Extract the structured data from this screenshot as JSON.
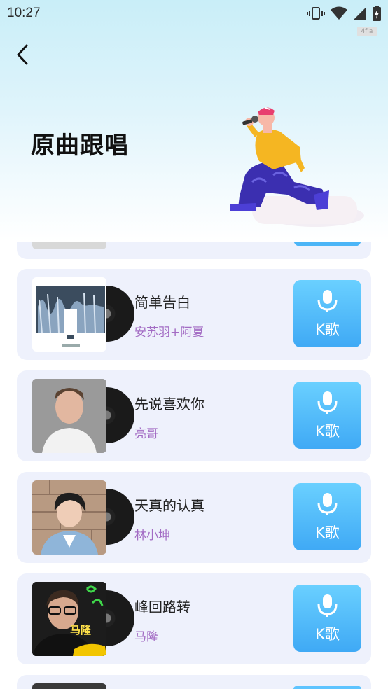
{
  "status_bar": {
    "time": "10:27",
    "watermark": "4fja"
  },
  "header": {
    "title": "原曲跟唱"
  },
  "songs": [
    {
      "title": "简单告白",
      "artist": "安苏羽+阿夏",
      "button_label": "K歌"
    },
    {
      "title": "先说喜欢你",
      "artist": "亮哥",
      "button_label": "K歌"
    },
    {
      "title": "天真的认真",
      "artist": "林小坤",
      "button_label": "K歌"
    },
    {
      "title": "峰回路转",
      "artist": "马隆",
      "button_label": "K歌",
      "cover_text": "马隆"
    }
  ],
  "colors": {
    "card_bg": "#eef1fc",
    "artist_text": "#a36cc4",
    "k_button": "#3fa9f5",
    "header_gradient_top": "#c9eef8"
  },
  "icons": {
    "back": "back-arrow-icon",
    "mic": "microphone-icon",
    "vibrate": "vibrate-icon",
    "wifi": "wifi-icon",
    "signal": "signal-icon",
    "battery": "battery-charging-icon"
  }
}
